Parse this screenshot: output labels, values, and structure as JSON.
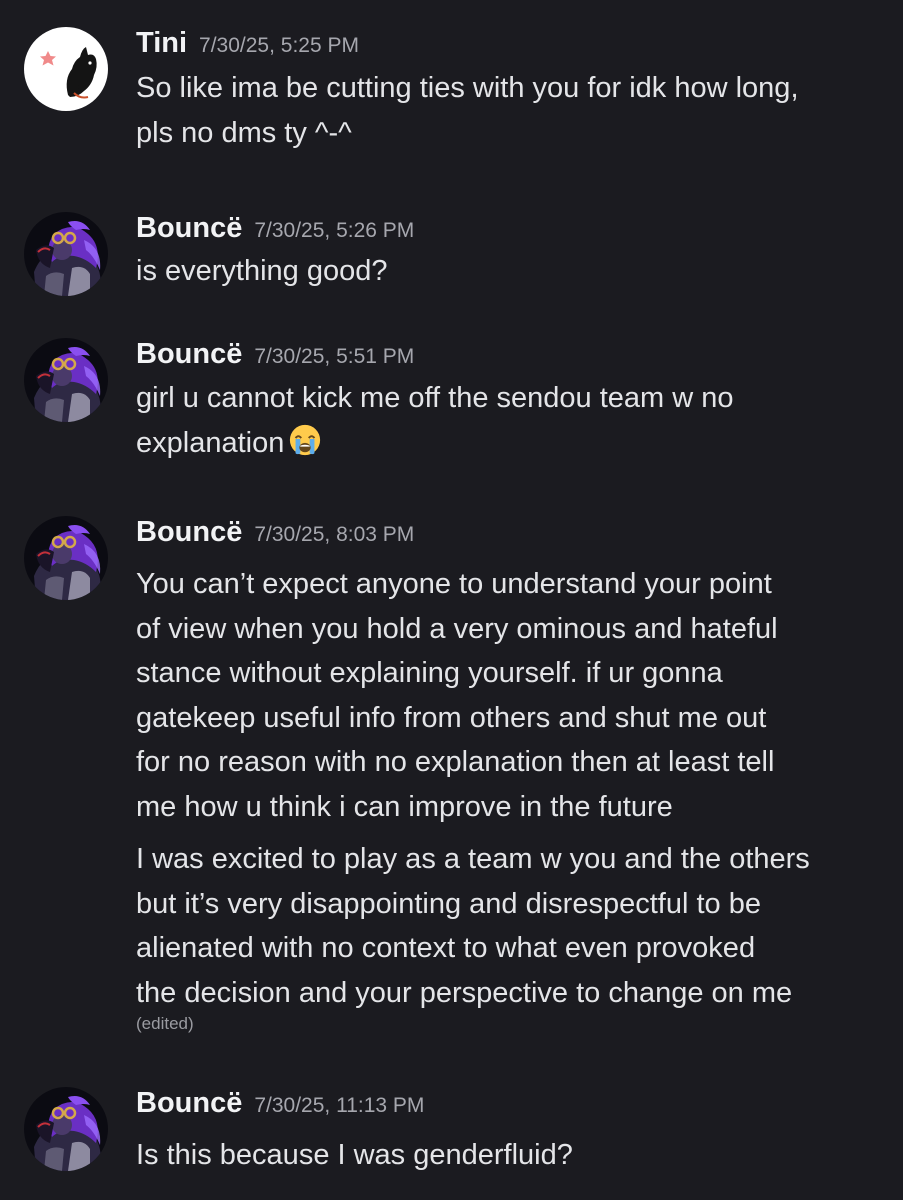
{
  "messages": [
    {
      "author": "Tini",
      "timestamp": "7/30/25, 5:25 PM",
      "paragraphs": [
        "So like ima be cutting ties with you for idk how long,\npls no dms ty ^-^"
      ],
      "avatar_icon": "tini-avatar-icon"
    },
    {
      "author": "Bouncë",
      "timestamp": "7/30/25, 5:26 PM",
      "paragraphs": [
        "is everything good?"
      ],
      "avatar_icon": "bounce-avatar-icon"
    },
    {
      "author": "Bouncë",
      "timestamp": "7/30/25, 5:51 PM",
      "paragraphs": [
        "girl u cannot kick me off the sendou team w no\nexplanation"
      ],
      "emoji": "loudly-crying-face-emoji",
      "avatar_icon": "bounce-avatar-icon"
    },
    {
      "author": "Bouncë",
      "timestamp": "7/30/25, 8:03 PM",
      "paragraphs": [
        "You can’t expect anyone to understand your point\nof view when you hold a very ominous and hateful\nstance without explaining yourself. if ur gonna\ngatekeep useful info from others and shut me out\nfor no reason with no explanation then at least tell\nme how u think i can improve in the future",
        "I was excited to play as a team w you and the others\nbut it’s very disappointing and disrespectful to be\nalienated with no context to what even provoked\nthe decision and your perspective to change on me"
      ],
      "edited_label": "(edited)",
      "avatar_icon": "bounce-avatar-icon"
    },
    {
      "author": "Bouncë",
      "timestamp": "7/30/25, 11:13 PM",
      "paragraphs": [
        "Is this because I was genderfluid?"
      ],
      "avatar_icon": "bounce-avatar-icon"
    }
  ],
  "colors": {
    "background": "#1b1b20",
    "username": "#f2f3f5",
    "timestamp": "#a6a7ae",
    "message_text": "#e4e5e8",
    "edited_text": "#9a9ba1"
  }
}
